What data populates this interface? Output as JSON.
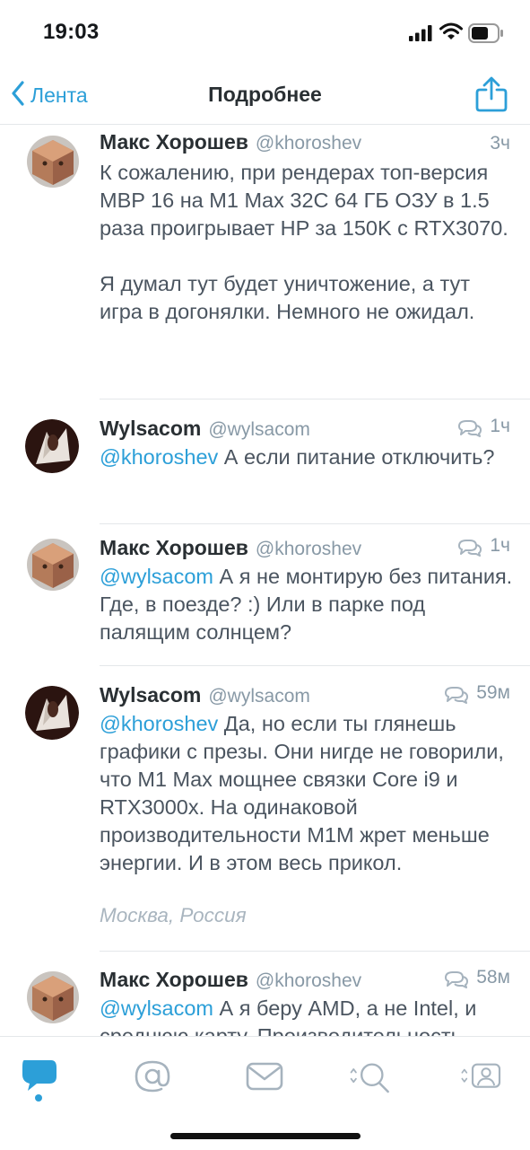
{
  "status_bar": {
    "time": "19:03"
  },
  "nav": {
    "back_label": "Лента",
    "title": "Подробнее"
  },
  "tweets": [
    {
      "name": "Макс Хорошев",
      "handle": "@khoroshev",
      "time": "3ч",
      "avatar": "max-avatar",
      "mention": "",
      "text": "К сожалению, при рендерах топ-версия MBP 16 на M1 Max 32C 64 ГБ ОЗУ в 1.5 раза проигрывает HP за 150K с RTX3070.\n\nЯ думал тут будет уничтожение, а тут игра в догонялки. Немного не ожидал."
    },
    {
      "name": "Wylsacom",
      "handle": "@wylsacom",
      "time": "1ч",
      "avatar": "wylsacom-avatar",
      "mention": "@khoroshev",
      "text": " А если питание отключить?"
    },
    {
      "name": "Макс Хорошев",
      "handle": "@khoroshev",
      "time": "1ч",
      "avatar": "max-avatar",
      "mention": "@wylsacom",
      "text": " А я не монтирую без питания. Где, в поезде? :) Или в парке под палящим солнцем?"
    },
    {
      "name": "Wylsacom",
      "handle": "@wylsacom",
      "time": "59м",
      "avatar": "wylsacom-avatar",
      "mention": "@khoroshev",
      "text": " Да, но если ты глянешь графики с презы. Они нигде не говорили, что M1 Max мощнее связки Core i9 и RTX3000x. На одинаковой производительности  M1M жрет меньше энергии. И в этом весь прикол.",
      "location": "Москва, Россия"
    },
    {
      "name": "Макс Хорошев",
      "handle": "@khoroshev",
      "time": "58м",
      "avatar": "max-avatar",
      "mention": "@wylsacom",
      "text": " А я беру AMD, а не Intel, и среднюю карту. Производительность"
    }
  ],
  "icons": {
    "back": "chevron-left-icon",
    "share": "share-icon",
    "reply": "conversation-icon",
    "tabs": [
      "timeline-icon",
      "mentions-icon",
      "messages-icon",
      "search-icon",
      "profile-icon"
    ]
  },
  "colors": {
    "accent": "#2c9fd8",
    "text": "#4b5560",
    "meta": "#8899a6",
    "separator": "#e4e7ea"
  }
}
